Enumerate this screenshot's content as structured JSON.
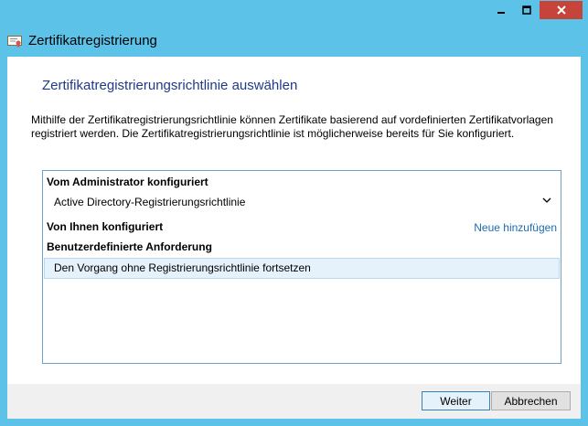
{
  "window": {
    "title": "Zertifikatregistrierung",
    "controls": {
      "minimize": "minimize-icon",
      "maximize": "maximize-icon",
      "close": "close-icon"
    }
  },
  "page": {
    "title": "Zertifikatregistrierungsrichtlinie auswählen",
    "description": "Mithilfe der Zertifikatregistrierungsrichtlinie können Zertifikate basierend auf vordefinierten Zertifikatvorlagen registriert werden. Die Zertifikatregistrierungsrichtlinie ist möglicherweise bereits für Sie konfiguriert."
  },
  "policies": {
    "admin_section": "Vom Administrator konfiguriert",
    "admin_policy": "Active Directory-Registrierungsrichtlinie",
    "user_section": "Von Ihnen konfiguriert",
    "add_new": "Neue hinzufügen",
    "custom_section": "Benutzerdefinierte Anforderung",
    "continue_without": "Den Vorgang ohne Registrierungsrichtlinie fortsetzen"
  },
  "footer": {
    "next": "Weiter",
    "cancel": "Abbrechen"
  },
  "colors": {
    "frame": "#5cc2e8",
    "close_button": "#c6443a",
    "title_text": "#1e3b87",
    "link": "#1d6bb5",
    "selection": "#e5f1fb"
  }
}
